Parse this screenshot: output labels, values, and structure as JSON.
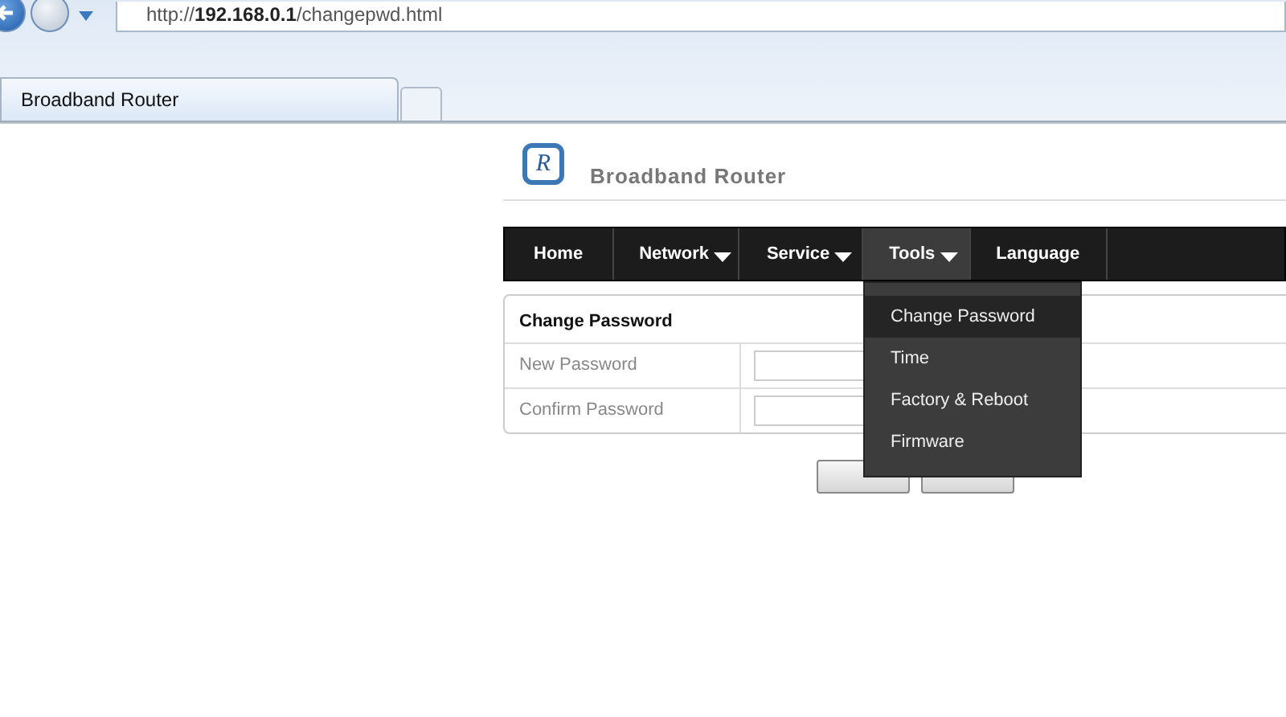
{
  "browser": {
    "address": "http://**192.168.0.1**/changepwd.html",
    "tab": {
      "label": "Broadband Router"
    }
  },
  "header": {
    "title": "Broadband Router",
    "logo_letter": "R"
  },
  "nav": [
    {
      "label": "Home",
      "has_menu": false,
      "selected": false
    },
    {
      "label": "Network",
      "has_menu": true,
      "selected": false
    },
    {
      "label": "Service",
      "has_menu": true,
      "selected": false
    },
    {
      "label": "Tools",
      "has_menu": true,
      "selected": true
    },
    {
      "label": "Language",
      "has_menu": false,
      "selected": false
    }
  ],
  "dropdown": [
    {
      "label": "Change Password",
      "selected": true
    },
    {
      "label": "Time",
      "selected": false
    },
    {
      "label": "Factory & Reboot",
      "selected": false
    },
    {
      "label": "Firmware",
      "selected": false
    }
  ],
  "form": {
    "title": "Change Password",
    "rows": [
      {
        "label": "New Password"
      },
      {
        "label": "Confirm Password"
      }
    ]
  },
  "buttons": [
    {
      "kind": "apply"
    },
    {
      "kind": "cancel"
    }
  ]
}
